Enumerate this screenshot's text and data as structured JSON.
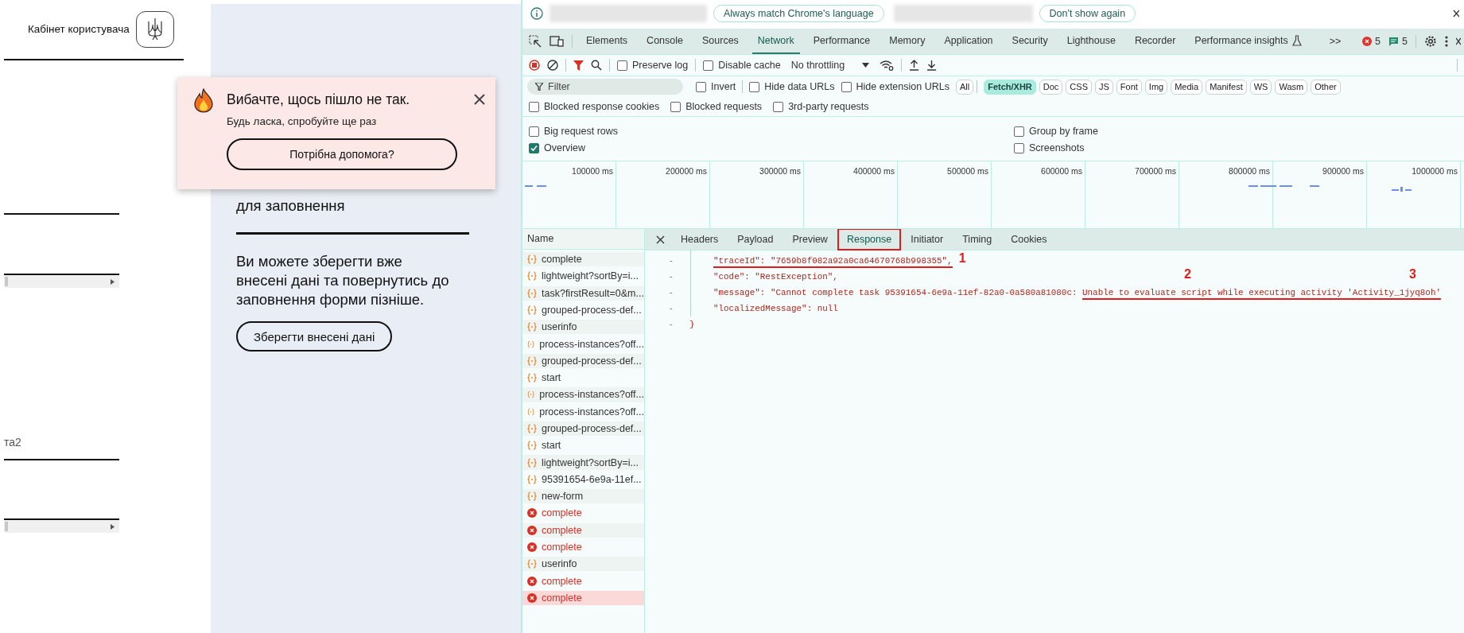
{
  "page": {
    "header_title": "Кабінет користувача",
    "form_label": "та2",
    "required_note": "для заповнення",
    "save_note": "Ви можете зберегти вже внесені дані та повернутись до заповнення форми пізніше.",
    "save_button": "Зберегти внесені дані"
  },
  "toast": {
    "title": "Вибачте, щось пішло не так.",
    "message": "Будь ласка, спробуйте ще раз",
    "help_button": "Потрібна допомога?"
  },
  "devtools": {
    "infobar": {
      "buttons": [
        "Always match Chrome's language",
        "Don't show again"
      ]
    },
    "tabs": [
      {
        "label": "Elements",
        "selected": false,
        "experimental": false
      },
      {
        "label": "Console",
        "selected": false,
        "experimental": false
      },
      {
        "label": "Sources",
        "selected": false,
        "experimental": false
      },
      {
        "label": "Network",
        "selected": true,
        "experimental": false
      },
      {
        "label": "Performance",
        "selected": false,
        "experimental": false
      },
      {
        "label": "Memory",
        "selected": false,
        "experimental": false
      },
      {
        "label": "Application",
        "selected": false,
        "experimental": false
      },
      {
        "label": "Security",
        "selected": false,
        "experimental": false
      },
      {
        "label": "Lighthouse",
        "selected": false,
        "experimental": false
      },
      {
        "label": "Recorder",
        "selected": false,
        "experimental": false
      },
      {
        "label": "Performance insights",
        "selected": false,
        "experimental": true
      }
    ],
    "more_tabs": ">>",
    "error_count": "5",
    "message_count": "5",
    "toolbar": {
      "checkboxes": [
        {
          "label": "Preserve log",
          "checked": false
        },
        {
          "label": "Disable cache",
          "checked": false
        }
      ],
      "throttling": "No throttling"
    },
    "filter": {
      "placeholder": "Filter",
      "checkboxes": [
        {
          "label": "Invert",
          "checked": false
        },
        {
          "label": "Hide data URLs",
          "checked": false
        },
        {
          "label": "Hide extension URLs",
          "checked": false
        }
      ],
      "types": [
        {
          "label": "All",
          "selected": false
        },
        {
          "label": "Fetch/XHR",
          "selected": true
        },
        {
          "label": "Doc",
          "selected": false
        },
        {
          "label": "CSS",
          "selected": false
        },
        {
          "label": "JS",
          "selected": false
        },
        {
          "label": "Font",
          "selected": false
        },
        {
          "label": "Img",
          "selected": false
        },
        {
          "label": "Media",
          "selected": false
        },
        {
          "label": "Manifest",
          "selected": false
        },
        {
          "label": "WS",
          "selected": false
        },
        {
          "label": "Wasm",
          "selected": false
        },
        {
          "label": "Other",
          "selected": false
        }
      ]
    },
    "blocked": [
      {
        "label": "Blocked response cookies",
        "checked": false
      },
      {
        "label": "Blocked requests",
        "checked": false
      },
      {
        "label": "3rd-party requests",
        "checked": false
      }
    ],
    "settings": [
      {
        "label": "Big request rows",
        "checked": false
      },
      {
        "label": "Group by frame",
        "checked": false
      },
      {
        "label": "Overview",
        "checked": true
      },
      {
        "label": "Screenshots",
        "checked": false
      }
    ],
    "timeline": {
      "ticks": [
        "100000 ms",
        "200000 ms",
        "300000 ms",
        "400000 ms",
        "500000 ms",
        "600000 ms",
        "700000 ms",
        "800000 ms",
        "900000 ms",
        "1000000 ms"
      ]
    },
    "requests": {
      "header": "Name",
      "rows": [
        {
          "name": "complete",
          "failed": false,
          "selected": false
        },
        {
          "name": "lightweight?sortBy=i...",
          "failed": false,
          "selected": false
        },
        {
          "name": "task?firstResult=0&m...",
          "failed": false,
          "selected": false
        },
        {
          "name": "grouped-process-def...",
          "failed": false,
          "selected": false
        },
        {
          "name": "userinfo",
          "failed": false,
          "selected": false
        },
        {
          "name": "process-instances?off...",
          "failed": false,
          "selected": false
        },
        {
          "name": "grouped-process-def...",
          "failed": false,
          "selected": false
        },
        {
          "name": "start",
          "failed": false,
          "selected": false
        },
        {
          "name": "process-instances?off...",
          "failed": false,
          "selected": false
        },
        {
          "name": "process-instances?off...",
          "failed": false,
          "selected": false
        },
        {
          "name": "grouped-process-def...",
          "failed": false,
          "selected": false
        },
        {
          "name": "start",
          "failed": false,
          "selected": false
        },
        {
          "name": "lightweight?sortBy=i...",
          "failed": false,
          "selected": false
        },
        {
          "name": "95391654-6e9a-11ef...",
          "failed": false,
          "selected": false
        },
        {
          "name": "new-form",
          "failed": false,
          "selected": false
        },
        {
          "name": "complete",
          "failed": true,
          "selected": false
        },
        {
          "name": "complete",
          "failed": true,
          "selected": false
        },
        {
          "name": "complete",
          "failed": true,
          "selected": false
        },
        {
          "name": "userinfo",
          "failed": false,
          "selected": false
        },
        {
          "name": "complete",
          "failed": true,
          "selected": false
        },
        {
          "name": "complete",
          "failed": true,
          "selected": true
        }
      ]
    },
    "detail": {
      "tabs": [
        {
          "label": "Headers",
          "selected": false,
          "boxed": false
        },
        {
          "label": "Payload",
          "selected": false,
          "boxed": false
        },
        {
          "label": "Preview",
          "selected": false,
          "boxed": false
        },
        {
          "label": "Response",
          "selected": true,
          "boxed": true
        },
        {
          "label": "Initiator",
          "selected": false,
          "boxed": false
        },
        {
          "label": "Timing",
          "selected": false,
          "boxed": false
        },
        {
          "label": "Cookies",
          "selected": false,
          "boxed": false
        }
      ],
      "lines": [
        {
          "gutter": "-",
          "parts": [
            {
              "text": "\"traceId\": \"7659b8f082a92a0ca64670768b998355\",",
              "underlined": true
            }
          ],
          "callouts": [
            "1"
          ]
        },
        {
          "gutter": "-",
          "parts": [
            {
              "text": "\"code\": \"RestException\",",
              "underlined": false
            }
          ]
        },
        {
          "gutter": "-",
          "parts": [
            {
              "text": "\"message\": \"Cannot complete task 95391654-6e9a-11ef-82a0-0a580a81080c: ",
              "underlined": false
            },
            {
              "text": "Unable to evaluate script while executing activity 'Activity_1jyq8oh'",
              "underlined": true
            }
          ],
          "callouts": [
            "2",
            "3"
          ]
        },
        {
          "gutter": "-",
          "parts": [
            {
              "text": "\"localizedMessage\": null",
              "underlined": false
            }
          ]
        }
      ],
      "closing": {
        "gutter": "-",
        "text": "}"
      }
    }
  }
}
